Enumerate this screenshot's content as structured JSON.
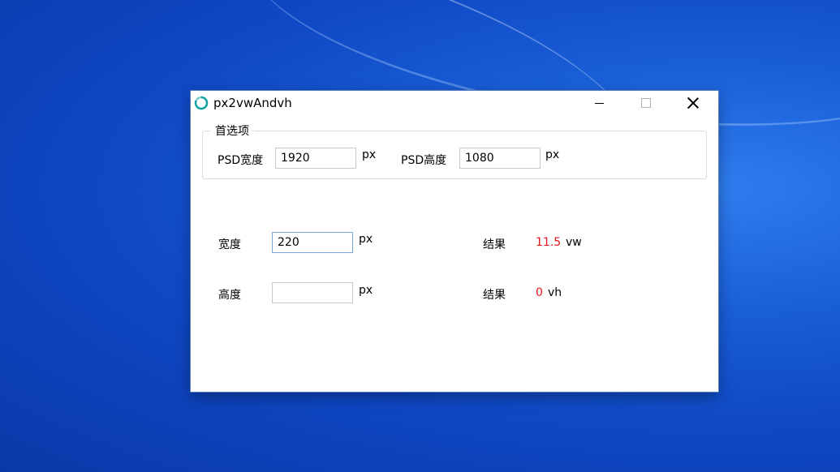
{
  "window": {
    "title": "px2vwAndvh",
    "accent": "#12a0a0"
  },
  "preferences": {
    "legend": "首选项",
    "psd_width_label": "PSD宽度",
    "psd_width_value": "1920",
    "psd_width_unit": "px",
    "psd_height_label": "PSD高度",
    "psd_height_value": "1080",
    "psd_height_unit": "px"
  },
  "width_row": {
    "label": "宽度",
    "value": "220",
    "unit": "px",
    "result_label": "结果",
    "result_value": "11.5",
    "result_unit": "vw"
  },
  "height_row": {
    "label": "高度",
    "value": "",
    "unit": "px",
    "result_label": "结果",
    "result_value": "0",
    "result_unit": "vh"
  },
  "colors": {
    "result": "#e8141b",
    "focus_border": "#7aa8d8"
  }
}
